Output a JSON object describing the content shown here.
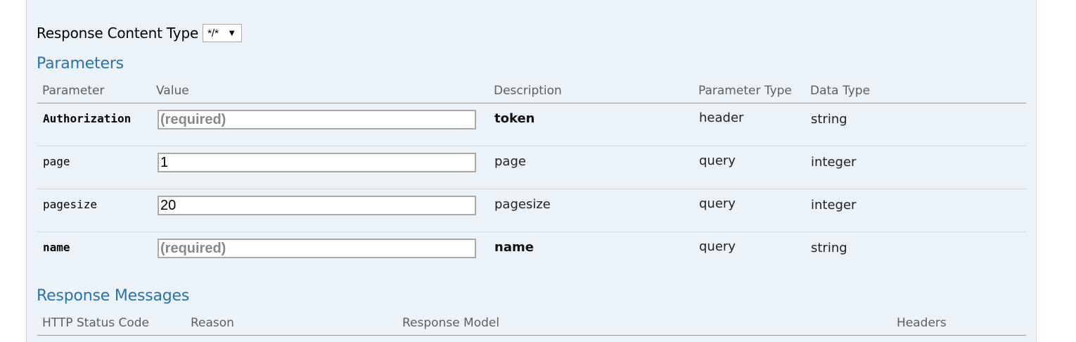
{
  "response_content_type": {
    "label": "Response Content Type",
    "selected": "*/*"
  },
  "parameters": {
    "title": "Parameters",
    "columns": {
      "parameter": "Parameter",
      "value": "Value",
      "description": "Description",
      "parameter_type": "Parameter Type",
      "data_type": "Data Type"
    },
    "rows": [
      {
        "name": "Authorization",
        "value": "",
        "placeholder": "(required)",
        "description": "token",
        "param_type": "header",
        "data_type": "string",
        "required": true
      },
      {
        "name": "page",
        "value": "1",
        "placeholder": "",
        "description": "page",
        "param_type": "query",
        "data_type": "integer",
        "required": false
      },
      {
        "name": "pagesize",
        "value": "20",
        "placeholder": "",
        "description": "pagesize",
        "param_type": "query",
        "data_type": "integer",
        "required": false
      },
      {
        "name": "name",
        "value": "",
        "placeholder": "(required)",
        "description": "name",
        "param_type": "query",
        "data_type": "string",
        "required": true
      }
    ]
  },
  "response_messages": {
    "title": "Response Messages",
    "columns": {
      "status_code": "HTTP Status Code",
      "reason": "Reason",
      "model": "Response Model",
      "headers": "Headers"
    }
  },
  "icons": {
    "dropdown": "chevron-down-icon"
  }
}
